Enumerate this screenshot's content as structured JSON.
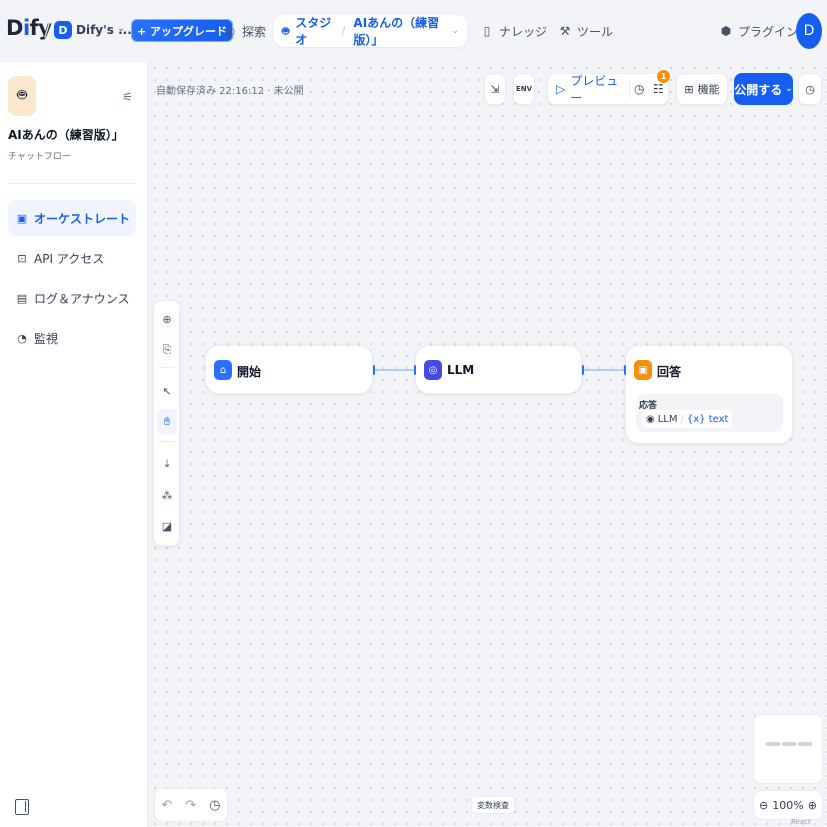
{
  "header": {
    "logo_text": "Dify",
    "workspace_initial": "D",
    "workspace_name": "Dify's ...",
    "upgrade_label": "+ アップグレード",
    "explore_label": "探索",
    "studio_label": "スタジオ",
    "current_app_label": "AIあんの（練習版）」",
    "knowledge_label": "ナレッジ",
    "tools_label": "ツール",
    "plugins_label": "プラグイン",
    "user_initial": "D",
    "accent_color": "#155eef"
  },
  "sidebar": {
    "app_name": "AIあんの（練習版）」",
    "app_type": "チャットフロー",
    "items": [
      {
        "label": "オーケストレート",
        "icon": "layout-icon",
        "active": true
      },
      {
        "label": "API アクセス",
        "icon": "terminal-icon",
        "active": false
      },
      {
        "label": "ログ＆アナウンス",
        "icon": "file-list-icon",
        "active": false
      },
      {
        "label": "監視",
        "icon": "gauge-icon",
        "active": false
      }
    ]
  },
  "canvas": {
    "autosave_text": "自動保存済み 22:16:12 · 未公開",
    "env_label": "ENV",
    "preview_label": "プレビュー",
    "checklist_badge": "1",
    "features_label": "機能",
    "publish_label": "公開する",
    "nodes": [
      {
        "id": "start",
        "title": "開始",
        "icon": "home-icon",
        "color": "#2970ff"
      },
      {
        "id": "llm",
        "title": "LLM",
        "icon": "llm-icon",
        "color": "#444ce7"
      },
      {
        "id": "answer",
        "title": "回答",
        "icon": "answer-icon",
        "color": "#f79009"
      }
    ],
    "answer_field_label": "応答",
    "answer_var_source": "LLM",
    "answer_var_name": "{x} text",
    "variable_inspect_label": "変数検査",
    "zoom_label": "100%",
    "attribution": "React Flow"
  }
}
